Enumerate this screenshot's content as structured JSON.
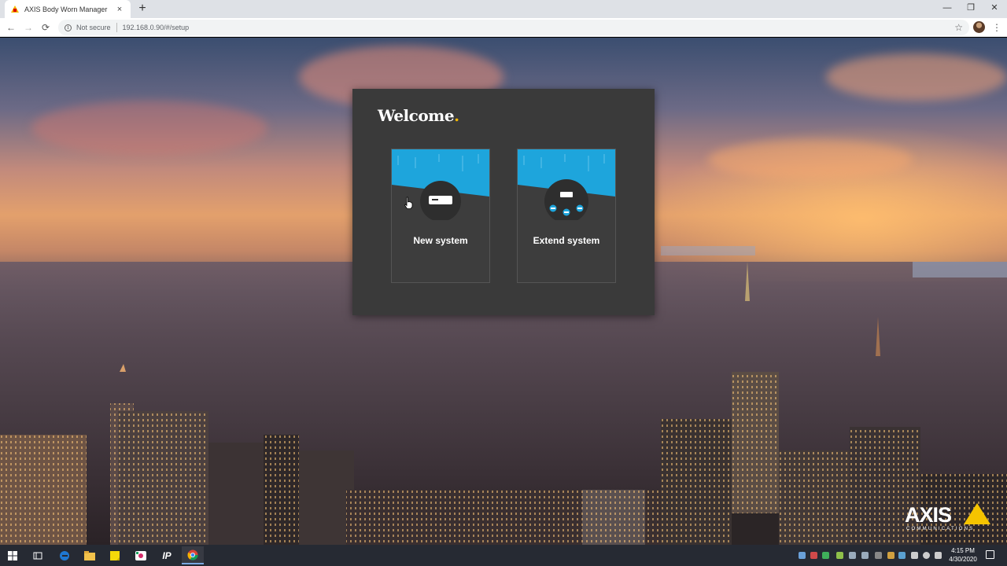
{
  "browser": {
    "tab_title": "AXIS Body Worn Manager",
    "tab_close": "×",
    "new_tab": "+",
    "window_controls": {
      "minimize": "—",
      "maximize": "❐",
      "close": "✕"
    },
    "nav": {
      "back": "←",
      "forward": "→",
      "reload": "⟳"
    },
    "security_label": "Not secure",
    "url": "192.168.0.90/#/setup",
    "bookmark_star": "☆",
    "menu": "⋮"
  },
  "welcome": {
    "title": "Welcome",
    "title_dot": ".",
    "cards": [
      {
        "label": "New system",
        "icon": "device-icon"
      },
      {
        "label": "Extend system",
        "icon": "device-network-icon"
      }
    ]
  },
  "brand": {
    "logo_word": "AXIS",
    "logo_sub": "COMMUNICATIONS",
    "accent": "#f5b800",
    "card_blue": "#1ea5dc"
  },
  "taskbar": {
    "time": "4:15 PM",
    "date": "4/30/2020",
    "pinned": [
      "windows-start-icon",
      "task-view-icon",
      "edge-icon",
      "file-explorer-icon",
      "sticky-notes-icon",
      "app-icon",
      "ip-app-icon",
      "chrome-icon"
    ],
    "ip_label": "IP"
  }
}
